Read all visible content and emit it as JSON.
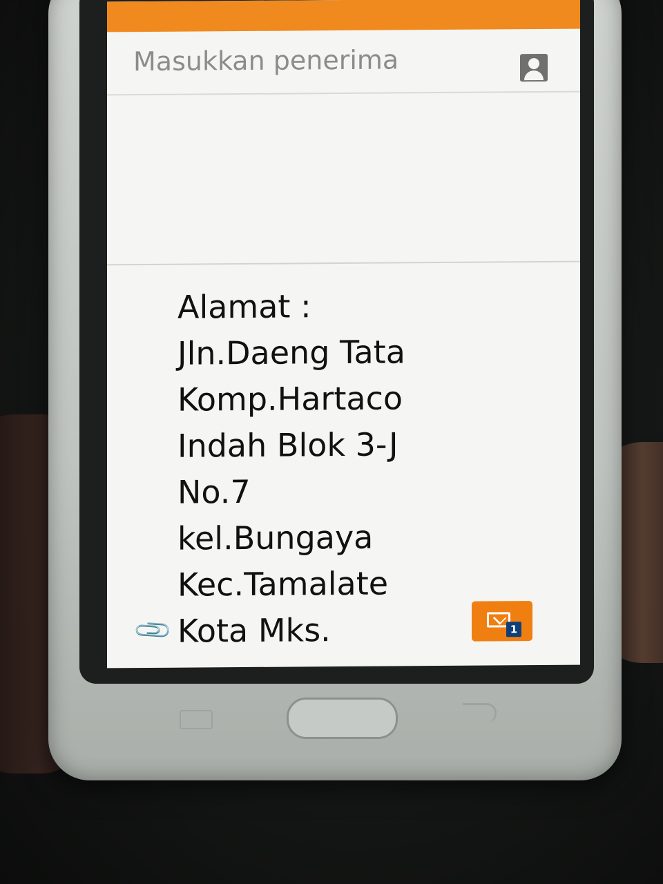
{
  "compose": {
    "recipient_placeholder": "Masukkan penerima",
    "contact_icon": "contact-person-icon"
  },
  "message": {
    "lines": [
      "Alamat :",
      "Jln.Daeng Tata",
      "Komp.Hartaco",
      "Indah Blok 3-J",
      "No.7",
      "kel.Bungaya",
      "Kec.Tamalate",
      "Kota Mks."
    ]
  },
  "actions": {
    "attach_icon": "paperclip-icon",
    "send_icon": "send-message-icon",
    "send_sim_number": "1"
  },
  "colors": {
    "accent": "#f08a1e",
    "send_button": "#f07f12",
    "sim_badge": "#0f3f7a"
  }
}
